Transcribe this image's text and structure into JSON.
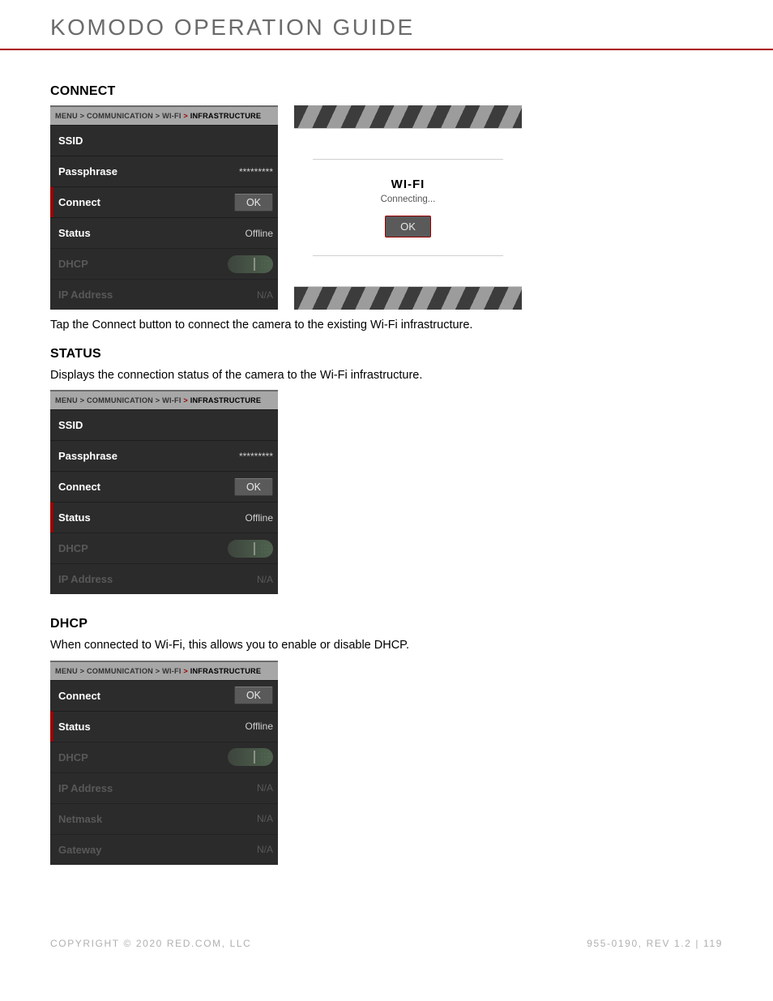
{
  "header": {
    "title": "KOMODO OPERATION GUIDE"
  },
  "breadcrumb": {
    "menu": "MENU",
    "comm": "COMMUNICATION",
    "wifi": "WI-FI",
    "infra": "INFRASTRUCTURE",
    "sep": ">"
  },
  "section_connect": {
    "heading": "CONNECT",
    "body": "Tap the Connect button to connect the camera to the existing Wi-Fi infrastructure.",
    "menu": {
      "ssid": {
        "label": "SSID",
        "value": ""
      },
      "passphrase": {
        "label": "Passphrase",
        "value": "*********"
      },
      "connect": {
        "label": "Connect",
        "button": "OK"
      },
      "status": {
        "label": "Status",
        "value": "Offline"
      },
      "dhcp": {
        "label": "DHCP"
      },
      "ip": {
        "label": "IP Address",
        "value": "N/A"
      }
    },
    "dialog": {
      "title": "WI-FI",
      "msg": "Connecting...",
      "ok": "OK"
    }
  },
  "section_status": {
    "heading": "STATUS",
    "body": "Displays the connection status of the camera to the Wi-Fi infrastructure.",
    "menu": {
      "ssid": {
        "label": "SSID",
        "value": ""
      },
      "passphrase": {
        "label": "Passphrase",
        "value": "*********"
      },
      "connect": {
        "label": "Connect",
        "button": "OK"
      },
      "status": {
        "label": "Status",
        "value": "Offline"
      },
      "dhcp": {
        "label": "DHCP"
      },
      "ip": {
        "label": "IP Address",
        "value": "N/A"
      }
    }
  },
  "section_dhcp": {
    "heading": "DHCP",
    "body": "When connected to Wi-Fi, this allows you to enable or disable DHCP.",
    "menu": {
      "connect": {
        "label": "Connect",
        "button": "OK"
      },
      "status": {
        "label": "Status",
        "value": "Offline"
      },
      "dhcp": {
        "label": "DHCP"
      },
      "ip": {
        "label": "IP Address",
        "value": "N/A"
      },
      "netmask": {
        "label": "Netmask",
        "value": "N/A"
      },
      "gateway": {
        "label": "Gateway",
        "value": "N/A"
      }
    }
  },
  "footer": {
    "copyright": "COPYRIGHT © 2020 RED.COM, LLC",
    "rev": "955-0190, REV 1.2  |  119"
  }
}
